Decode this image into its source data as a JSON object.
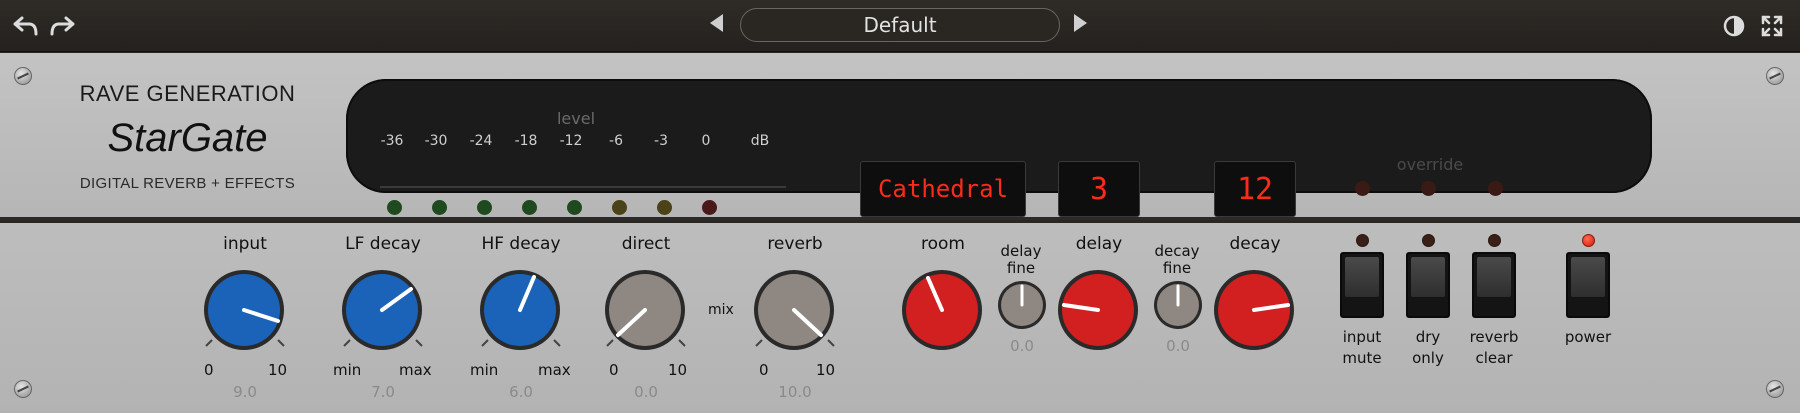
{
  "toolbar": {
    "undo_icon": "undo-icon",
    "redo_icon": "redo-icon",
    "preset_name": "Default",
    "contrast_icon": "contrast-icon",
    "fullscreen_icon": "fullscreen-icon"
  },
  "brand": {
    "maker": "RAVE GENERATION",
    "product": "StarGate",
    "subtitle": "DIGITAL REVERB + EFFECTS"
  },
  "meter": {
    "title": "level",
    "scale": [
      "-36",
      "-30",
      "-24",
      "-18",
      "-12",
      "-6",
      "-3",
      "0",
      "dB"
    ]
  },
  "displays": {
    "program": "Cathedral",
    "display_2": "3",
    "display_3": "12",
    "override_label": "override"
  },
  "knobs": {
    "input": {
      "label": "input",
      "min": "0",
      "max": "10",
      "value": "9.0"
    },
    "lf_decay": {
      "label": "LF decay",
      "min": "min",
      "max": "max",
      "value": "7.0"
    },
    "hf_decay": {
      "label": "HF decay",
      "min": "min",
      "max": "max",
      "value": "6.0"
    },
    "direct": {
      "label": "direct",
      "min": "0",
      "max": "10",
      "value": "0.0"
    },
    "mix_label": "mix",
    "reverb": {
      "label": "reverb",
      "min": "0",
      "max": "10",
      "value": "10.0"
    },
    "room": {
      "label": "room"
    },
    "delay_fine": {
      "label_1": "delay",
      "label_2": "fine",
      "value": "0.0"
    },
    "delay": {
      "label": "delay"
    },
    "decay_fine": {
      "label_1": "decay",
      "label_2": "fine",
      "value": "0.0"
    },
    "decay": {
      "label": "decay"
    }
  },
  "switches": {
    "input_mute": {
      "line1": "input",
      "line2": "mute"
    },
    "dry_only": {
      "line1": "dry",
      "line2": "only"
    },
    "reverb_clear": {
      "line1": "reverb",
      "line2": "clear"
    },
    "power": {
      "line1": "power"
    }
  },
  "colors": {
    "blue_knob": "#1a63b8",
    "gray_knob": "#8e8782",
    "red_knob": "#d21f1f",
    "lcd_text": "#ff2a1a"
  }
}
